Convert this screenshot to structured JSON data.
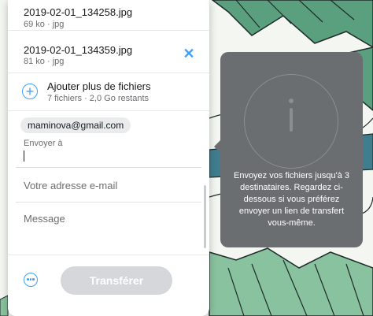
{
  "files": [
    {
      "name": "2019-02-01_134258.jpg",
      "size": "69 ko",
      "type": "jpg"
    },
    {
      "name": "2019-02-01_134359.jpg",
      "size": "81 ko",
      "type": "jpg"
    }
  ],
  "meta_separator": "·",
  "remove_symbol": "✕",
  "add_files": {
    "label": "Ajouter plus de fichiers",
    "sub": "7 fichiers · 2,0 Go restants",
    "symbol": "+"
  },
  "recipient": {
    "email": "maminova@gmail.com",
    "label": "Envoyer à"
  },
  "your_email": {
    "placeholder": "Votre adresse e-mail"
  },
  "message": {
    "placeholder": "Message"
  },
  "transfer_label": "Transférer",
  "tooltip": {
    "text": "Envoyez vos fichiers jusqu'à 3 destinataires. Regardez ci-dessous si vous préférez envoyer un lien de transfert vous-même."
  },
  "colors": {
    "accent": "#409fff",
    "tooltip_bg": "#6b6e71",
    "button_disabled": "#d5d7da"
  }
}
